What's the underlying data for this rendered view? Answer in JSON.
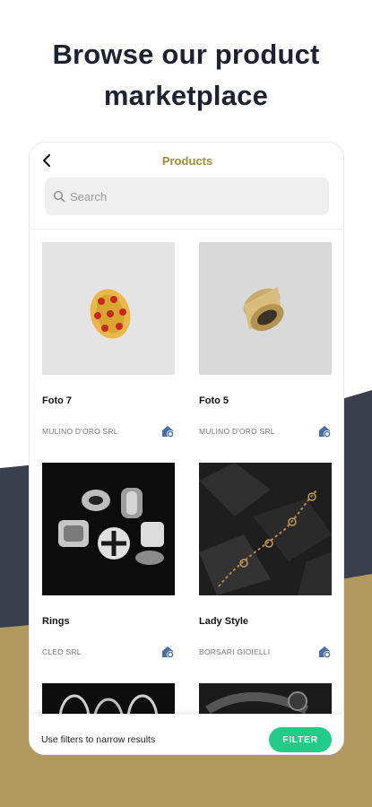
{
  "headline": "Browse our product marketplace",
  "colors": {
    "background_top": "#ffffff",
    "background_dark": "#3a3f4e",
    "background_gold": "#b09a5f",
    "accent_title": "#a08a3e",
    "filter_button": "#22cc88"
  },
  "header": {
    "back_icon": "chevron-left-icon",
    "title": "Products"
  },
  "search": {
    "placeholder": "Search",
    "value": ""
  },
  "products": [
    {
      "name": "Foto 7",
      "seller": "MULINO D'ORO SRL",
      "image": "gold ring with red hearts",
      "shop_icon": "shop-settings-icon"
    },
    {
      "name": "Foto 5",
      "seller": "MULINO D'ORO SRL",
      "image": "gold band ring",
      "shop_icon": "shop-settings-icon"
    },
    {
      "name": "Rings",
      "seller": "CLEO SRL",
      "image": "silver rings set",
      "shop_icon": "shop-settings-icon"
    },
    {
      "name": "Lady Style",
      "seller": "BORSARI GIOIELLI",
      "image": "gold chain necklace on rocks",
      "shop_icon": "shop-settings-icon"
    },
    {
      "name": "",
      "seller": "",
      "image": "silver hoop earrings",
      "shop_icon": ""
    },
    {
      "name": "",
      "seller": "",
      "image": "black bracelet and ring",
      "shop_icon": ""
    }
  ],
  "bottom_bar": {
    "hint": "Use filters to narrow results",
    "filter_label": "FILTER"
  }
}
